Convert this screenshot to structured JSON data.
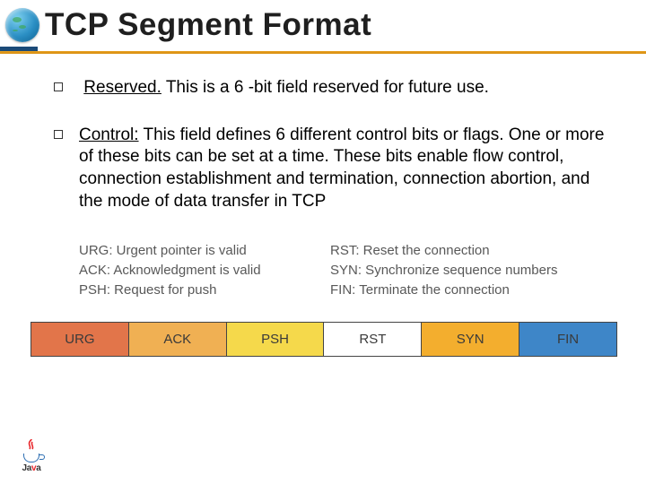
{
  "slide": {
    "title": "TCP Segment Format"
  },
  "bullets": {
    "reserved_term": "Reserved.",
    "reserved_rest": " This is a 6 -bit field reserved for future use.",
    "control_term": "Control:",
    "control_rest": " This field defines 6 different control bits or flags. One or more of these bits can be set at a time. These bits enable flow control, connection establishment and termination, connection abortion, and the mode of data transfer in TCP"
  },
  "flag_defs": {
    "left": [
      {
        "abbr": "URG:",
        "desc": " Urgent pointer is valid"
      },
      {
        "abbr": "ACK:",
        "desc": " Acknowledgment is valid"
      },
      {
        "abbr": "PSH:",
        "desc": " Request for push"
      }
    ],
    "right": [
      {
        "abbr": "RST:",
        "desc": " Reset the connection"
      },
      {
        "abbr": "SYN:",
        "desc": " Synchronize sequence numbers"
      },
      {
        "abbr": "FIN:",
        "desc": " Terminate the connection"
      }
    ]
  },
  "flag_bar": {
    "urg": "URG",
    "ack": "ACK",
    "psh": "PSH",
    "rst": "RST",
    "syn": "SYN",
    "fin": "FIN"
  },
  "logo": {
    "text_plain": "Ja",
    "text_red": "v",
    "text_plain2": "a"
  },
  "colors": {
    "accent_bar": "#d68c0e",
    "title_rule": "#1b4a78",
    "urg": "#e2754a",
    "ack": "#f0b053",
    "psh": "#f5d94b",
    "rst": "#ffffff",
    "syn": "#f3ae2e",
    "fin": "#3e86c8"
  }
}
